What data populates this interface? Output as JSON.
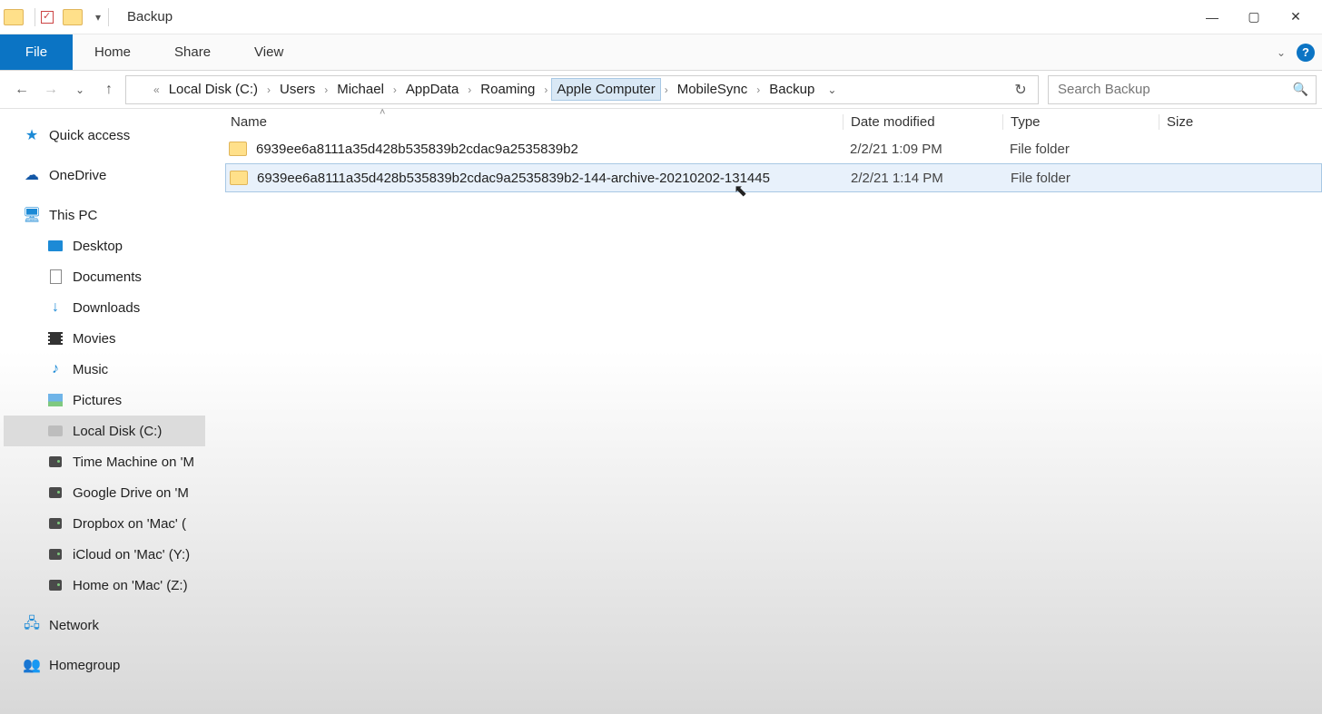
{
  "title": "Backup",
  "ribbon": {
    "file_label": "File",
    "tabs": [
      "Home",
      "Share",
      "View"
    ]
  },
  "breadcrumb": {
    "items": [
      "Local Disk (C:)",
      "Users",
      "Michael",
      "AppData",
      "Roaming",
      "Apple Computer",
      "MobileSync",
      "Backup"
    ]
  },
  "search": {
    "placeholder": "Search Backup"
  },
  "columns": {
    "name": "Name",
    "date": "Date modified",
    "type": "Type",
    "size": "Size"
  },
  "rows": [
    {
      "name": "6939ee6a8111a35d428b535839b2cdac9a2535839b2",
      "date": "2/2/21 1:09 PM",
      "type": "File folder",
      "size": "",
      "selected": false
    },
    {
      "name": "6939ee6a8111a35d428b535839b2cdac9a2535839b2-144-archive-20210202-131445",
      "date": "2/2/21 1:14 PM",
      "type": "File folder",
      "size": "",
      "selected": true
    }
  ],
  "sidebar": {
    "quick_access": "Quick access",
    "onedrive": "OneDrive",
    "this_pc": "This PC",
    "children": [
      "Desktop",
      "Documents",
      "Downloads",
      "Movies",
      "Music",
      "Pictures",
      "Local Disk (C:)",
      "Time Machine on 'M",
      "Google Drive on 'M",
      "Dropbox on 'Mac' (",
      "iCloud on 'Mac' (Y:)",
      "Home on 'Mac' (Z:)"
    ],
    "network": "Network",
    "homegroup": "Homegroup"
  }
}
